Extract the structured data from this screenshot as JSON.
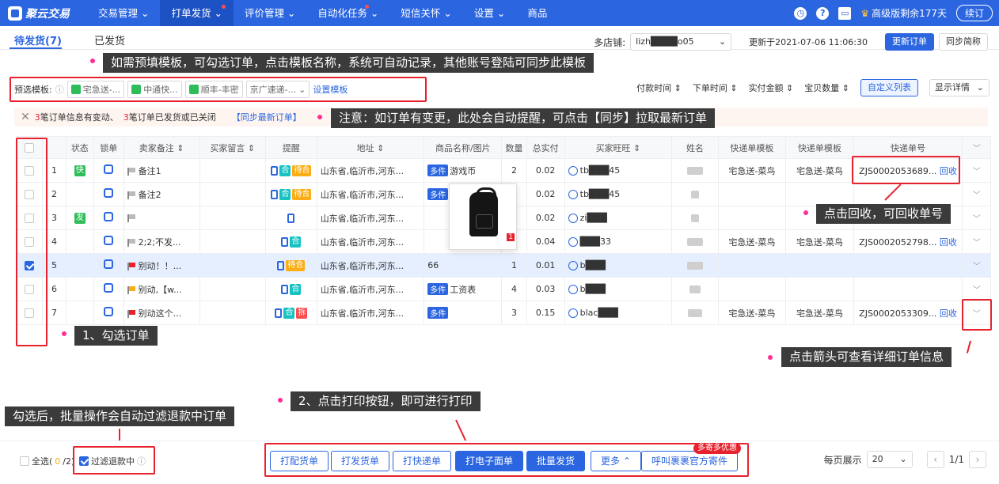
{
  "app": {
    "logo": "聚云交易"
  },
  "nav": [
    "交易管理",
    "打单发货",
    "评价管理",
    "自动化任务",
    "短信关怀",
    "设置",
    "商品"
  ],
  "topright": {
    "plan": "高级版剩余177天",
    "renew": "续订"
  },
  "tabs": [
    "待发货(7)",
    "已发货"
  ],
  "shop": {
    "label": "多店铺:",
    "value": "lizh████o05",
    "updated": "更新于2021-07-06 11:06:30",
    "refresh": "更新订单",
    "sync": "同步简称"
  },
  "tips": {
    "t1": "如需预填模板，可勾选订单，点击模板名称，系统可自动记录，其他账号登陆可同步此模板",
    "t2": "注意：如订单有变更，此处会自动提醒，可点击【同步】拉取最新订单",
    "t3": "点击回收，可回收单号",
    "t4": "1、勾选订单",
    "t5": "点击箭头可查看详细订单信息",
    "t6": "2、点击打印按钮，即可进行打印",
    "t7": "勾选后，批量操作会自动过滤退款中订单"
  },
  "templates": {
    "label": "预选模板:",
    "items": [
      "宅急送-...",
      "中通快...",
      "顺丰-丰密",
      "京广速递-..."
    ],
    "setting": "设置模板"
  },
  "sorters": [
    "付款时间",
    "下单时间",
    "实付金额",
    "宝贝数量"
  ],
  "custom_cols": "自定义列表",
  "display": "显示详情",
  "notice": {
    "n1": "3",
    "t1": "笔订单信息有变动、",
    "n2": "3",
    "t2": "笔订单已发货或已关闭",
    "link": "【同步最新订单】"
  },
  "columns": [
    "",
    "",
    "状态",
    "锁单",
    "卖家备注",
    "买家留言",
    "提醒",
    "地址",
    "商品名称/图片",
    "数量",
    "总实付",
    "买家旺旺",
    "姓名",
    "快递单模板",
    "快递单模板",
    "快递单号",
    ""
  ],
  "rows": [
    {
      "n": "1",
      "status": "快",
      "note": "备注1",
      "addr": "山东省,临沂市,河东...",
      "goods": "游戏币",
      "qty": "2",
      "pay": "0.02",
      "ww": "tb███45",
      "tpl1": "宅急送-菜鸟",
      "tpl2": "宅急送-菜鸟",
      "no": "ZJS0002053689...",
      "recycle": "回收"
    },
    {
      "n": "2",
      "status": "",
      "note": "备注2",
      "addr": "山东省,临沂市,河东...",
      "goods": "",
      "qty": "",
      "pay": "0.02",
      "ww": "tb███45",
      "tpl1": "",
      "tpl2": "",
      "no": "",
      "recycle": ""
    },
    {
      "n": "3",
      "status": "发",
      "note": "",
      "addr": "山东省,临沂市,河东...",
      "goods": "",
      "qty": "",
      "pay": "0.02",
      "ww": "zi███",
      "tpl1": "",
      "tpl2": "",
      "no": "",
      "recycle": ""
    },
    {
      "n": "4",
      "status": "",
      "note": "2;2;不发...",
      "addr": "山东省,临沂市,河东...",
      "goods": "",
      "qty": "",
      "pay": "0.04",
      "ww": "███33",
      "tpl1": "宅急送-菜鸟",
      "tpl2": "宅急送-菜鸟",
      "no": "ZJS0002052798...",
      "recycle": "回收"
    },
    {
      "n": "5",
      "status": "",
      "note": "别动！！...",
      "addr": "山东省,临沂市,河东...",
      "goods": "66",
      "qty": "1",
      "pay": "0.01",
      "ww": "b███",
      "tpl1": "",
      "tpl2": "",
      "no": "",
      "recycle": ""
    },
    {
      "n": "6",
      "status": "",
      "note": "别动,【w...",
      "addr": "山东省,临沂市,河东...",
      "goods": "工资表",
      "qty": "4",
      "pay": "0.03",
      "ww": "b███",
      "tpl1": "",
      "tpl2": "",
      "no": "",
      "recycle": ""
    },
    {
      "n": "7",
      "status": "",
      "note": "别动这个...",
      "addr": "山东省,临沂市,河东...",
      "goods": "",
      "qty": "3",
      "pay": "0.15",
      "ww": "blac███",
      "tpl1": "宅急送-菜鸟",
      "tpl2": "宅急送-菜鸟",
      "no": "ZJS0002053309...",
      "recycle": "回收"
    }
  ],
  "multi_tag": "多件",
  "popup_count": "1",
  "footer": {
    "select_all": "全选(",
    "sel": "0",
    "total": "/2)",
    "filter": "过滤退款中",
    "page_size_label": "每页展示",
    "page_size": "20",
    "page": "1/1",
    "promo": "多寄多优惠"
  },
  "actions": [
    "打配货单",
    "打发货单",
    "打快递单",
    "打电子面单",
    "批量发货",
    "更多",
    "呼叫裹裹官方寄件"
  ]
}
